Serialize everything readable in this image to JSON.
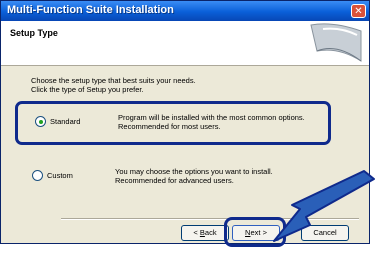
{
  "window": {
    "title": "Multi-Function Suite Installation",
    "close_glyph": "✕"
  },
  "header": {
    "title": "Setup Type"
  },
  "intro": {
    "line1": "Choose the setup type that best suits your needs.",
    "line2": "Click the type of Setup you prefer."
  },
  "options": [
    {
      "label": "Standard",
      "selected": true,
      "desc1": "Program will be installed with the most common options.",
      "desc2": "Recommended for most users."
    },
    {
      "label": "Custom",
      "selected": false,
      "desc1": "You may choose the options you want to install.",
      "desc2": "Recommended for advanced users."
    }
  ],
  "buttons": {
    "back_mnemonic": "B",
    "back_rest": "ack",
    "next_mnemonic": "N",
    "next_rest": "ext",
    "cancel": "Cancel"
  },
  "colors": {
    "titlebar": "#0a5fd8",
    "highlight": "#0f2a8c",
    "arrow": "#2a5fb8",
    "radio_dot": "#21a121"
  },
  "icons": {
    "close": "close-icon",
    "pointer": "arrow-pointer-icon"
  }
}
